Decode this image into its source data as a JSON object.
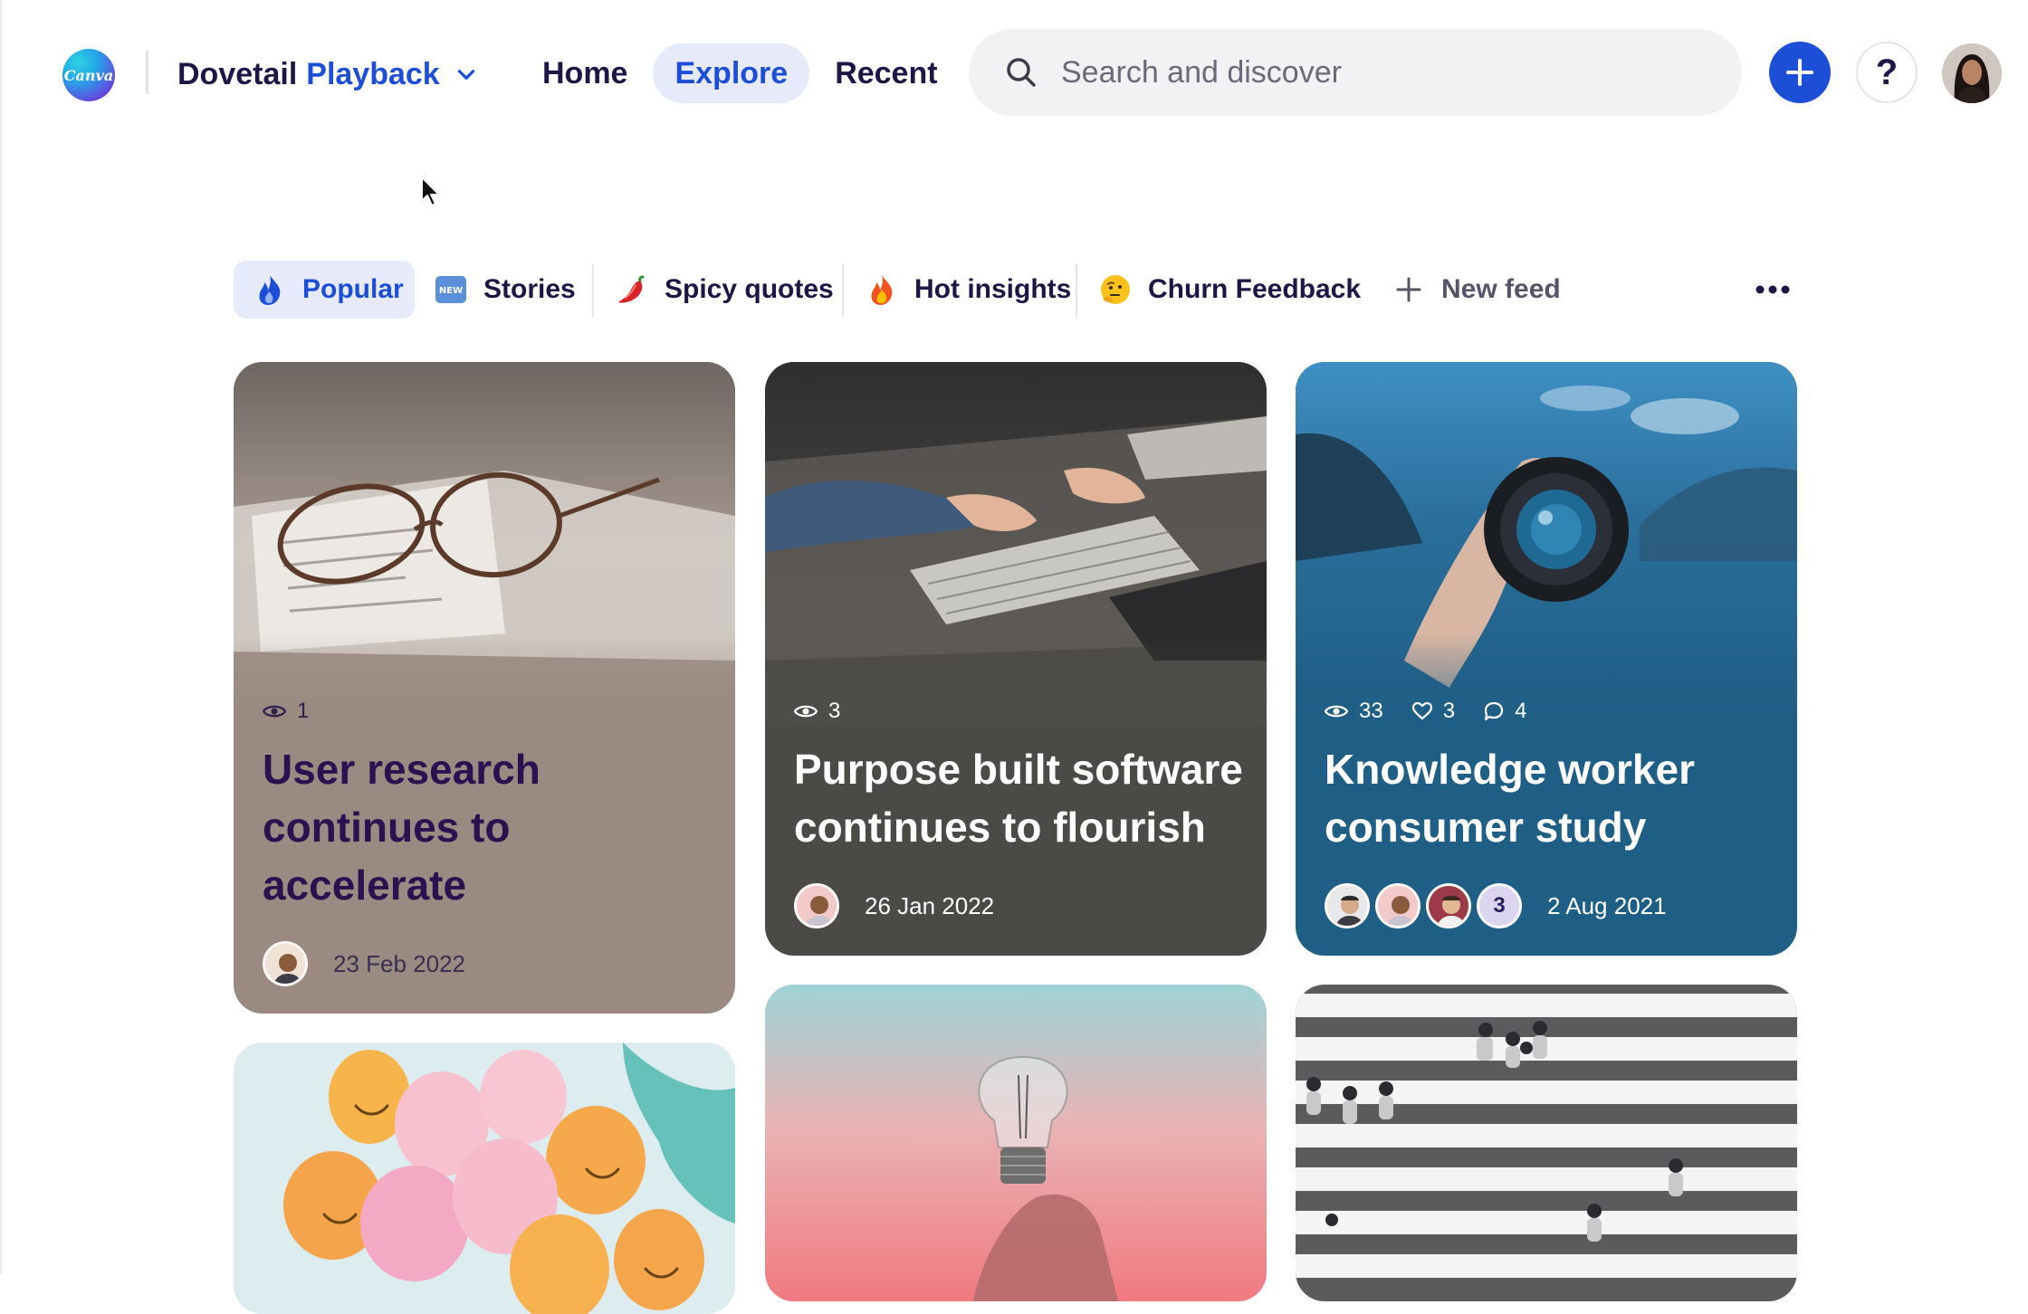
{
  "app": {
    "logo_text": "Canva",
    "workspace_name": "Dovetail",
    "workspace_project": "Playback"
  },
  "nav": {
    "items": [
      {
        "label": "Home",
        "active": false
      },
      {
        "label": "Explore",
        "active": true
      },
      {
        "label": "Recent",
        "active": false
      }
    ]
  },
  "search": {
    "placeholder": "Search and discover"
  },
  "header_actions": {
    "help_label": "?"
  },
  "tabs": {
    "items": [
      {
        "label": "Popular",
        "icon": "fire-hand-icon",
        "active": true
      },
      {
        "label": "Stories",
        "icon": "new-badge-icon",
        "active": false
      },
      {
        "label": "Spicy quotes",
        "icon": "chili-pepper-icon",
        "active": false
      },
      {
        "label": "Hot insights",
        "icon": "fire-icon",
        "active": false
      },
      {
        "label": "Churn Feedback",
        "icon": "thinking-face-icon",
        "active": false
      }
    ],
    "new_feed_label": "New feed"
  },
  "cards": [
    {
      "views": "1",
      "title": "User research continues to accelerate",
      "date": "23 Feb 2022",
      "bg": "#9a8a82"
    },
    {
      "views": "3",
      "title": "Purpose built software continues to flourish",
      "date": "26 Jan 2022",
      "bg": "#4b4a47"
    },
    {
      "views": "33",
      "likes": "3",
      "comments": "4",
      "title": "Knowledge worker consumer study",
      "extra_count": "3",
      "date": "2 Aug 2021",
      "bg": "#1f5e85"
    }
  ],
  "colors": {
    "accent": "#1d4ed8",
    "active_tab_bg": "#e6eafa",
    "text_dark": "#1f1646"
  }
}
